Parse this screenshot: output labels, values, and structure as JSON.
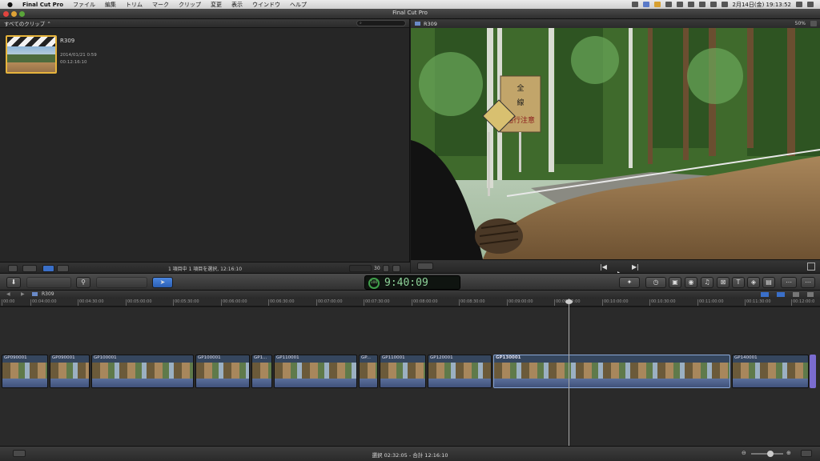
{
  "menubar": {
    "apple": "",
    "app": "Final Cut Pro",
    "items": [
      "ファイル",
      "編集",
      "トリム",
      "マーク",
      "クリップ",
      "変更",
      "表示",
      "ウインドウ",
      "ヘルプ"
    ],
    "clock": "2月14日(金)  19:13:52"
  },
  "window": {
    "title": "Final Cut Pro"
  },
  "browser": {
    "header": "すべてのクリップ ⌃",
    "clip": {
      "name": "R309",
      "date": "2014/01/21 0:59",
      "duration": "00:12:16:10"
    },
    "footer_text": "1 項目中 1 項目を選択, 12:16:10",
    "zoom_value": "30"
  },
  "viewer": {
    "title": "R309",
    "zoom": "50%",
    "sign_lines": [
      "全",
      "線",
      "通行注意"
    ]
  },
  "timecode": {
    "value": "9:40:09",
    "mode": "100"
  },
  "timeline": {
    "project": "R309",
    "ruler": [
      "00:00",
      "00:04:00:00",
      "00:04:30:00",
      "00:05:00:00",
      "00:05:30:00",
      "00:06:00:00",
      "00:06:30:00",
      "00:07:00:00",
      "00:07:30:00",
      "00:08:00:00",
      "00:08:30:00",
      "00:09:00:00",
      "00:09:30:00",
      "00:10:00:00",
      "00:10:30:00",
      "00:11:00:00",
      "00:11:30:00",
      "00:12:00:0"
    ],
    "clips": [
      {
        "label": "GP090001"
      },
      {
        "label": "GP090001"
      },
      {
        "label": "GP100001"
      },
      {
        "label": "GP100001"
      },
      {
        "label": "GP1..."
      },
      {
        "label": "GP110001"
      },
      {
        "label": "GP..."
      },
      {
        "label": "GP110001"
      },
      {
        "label": "GP120001"
      },
      {
        "label": "GP130001"
      },
      {
        "label": "GP140001"
      }
    ]
  },
  "status": {
    "text": "選択 02:32:05 - 合計 12:16:10"
  },
  "colors": {
    "accent": "#3a6fc8",
    "clip_border": "#e6b43c",
    "timecode": "#8fd49a"
  }
}
